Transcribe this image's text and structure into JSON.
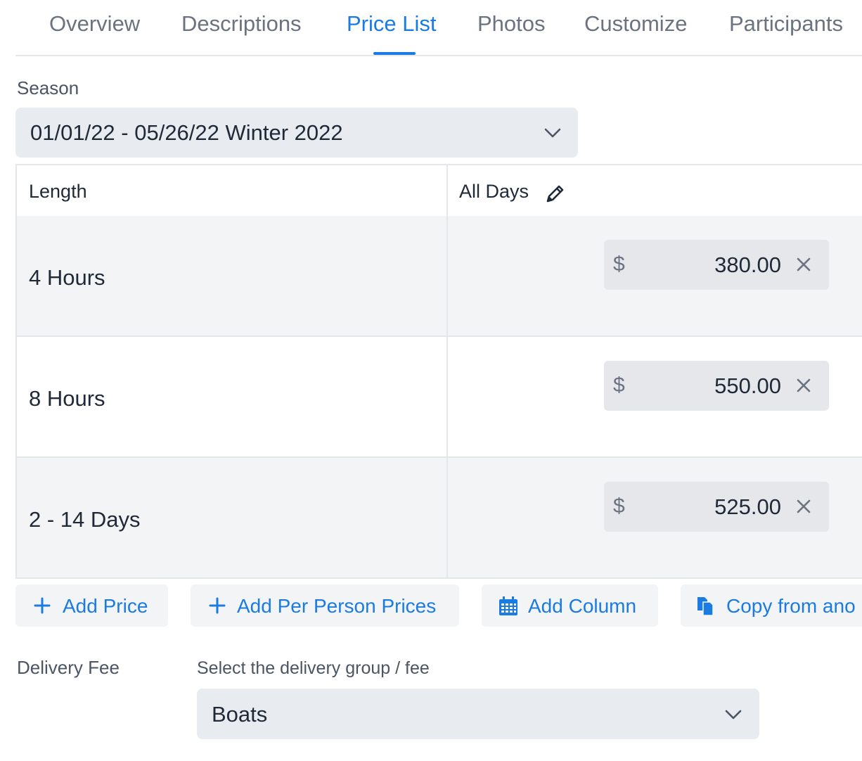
{
  "tabs": [
    {
      "label": "Overview"
    },
    {
      "label": "Descriptions"
    },
    {
      "label": "Price List",
      "active": true
    },
    {
      "label": "Photos"
    },
    {
      "label": "Customize"
    },
    {
      "label": "Participants"
    }
  ],
  "season": {
    "label": "Season",
    "selected": "01/01/22 - 05/26/22 Winter 2022"
  },
  "table": {
    "headers": {
      "length": "Length",
      "days": "All Days"
    },
    "rows": [
      {
        "length": "4 Hours",
        "currency": "$",
        "price": "380.00"
      },
      {
        "length": "8 Hours",
        "currency": "$",
        "price": "550.00"
      },
      {
        "length": "2 - 14 Days",
        "currency": "$",
        "price": "525.00"
      }
    ]
  },
  "buttons": {
    "add_price": "Add Price",
    "add_per_person": "Add Per Person Prices",
    "add_column": "Add Column",
    "copy_from": "Copy from ano"
  },
  "delivery": {
    "label": "Delivery Fee",
    "hint": "Select the delivery group / fee",
    "selected": "Boats"
  },
  "colors": {
    "accent": "#1a7be3",
    "muted_text": "#6b7280",
    "field_bg": "#e8ebf0"
  },
  "icons": [
    "pencil-icon",
    "close-icon",
    "plus-icon",
    "calendar-icon",
    "copy-icon",
    "chevron-down-icon"
  ]
}
